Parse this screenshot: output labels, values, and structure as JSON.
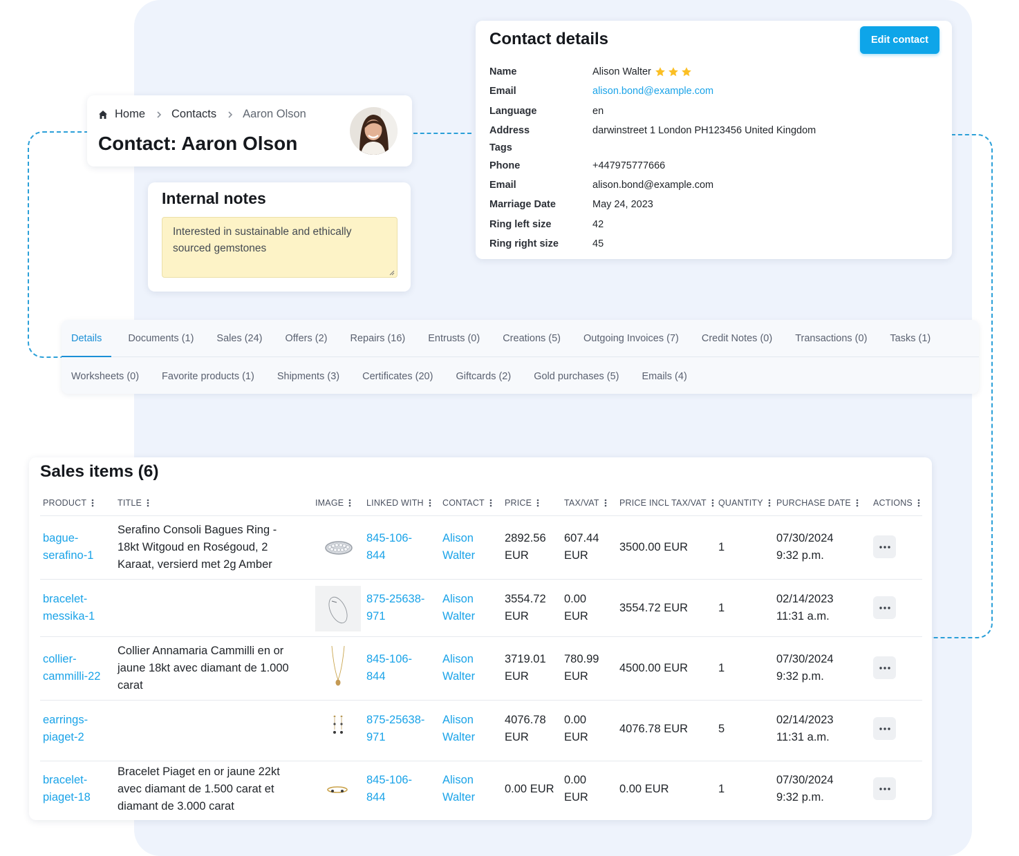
{
  "breadcrumb": {
    "home": "Home",
    "contacts": "Contacts",
    "current": "Aaron Olson"
  },
  "page_title": "Contact: Aaron Olson",
  "internal_notes": {
    "title": "Internal notes",
    "text": "Interested in sustainable and ethically sourced gemstones"
  },
  "contact_details": {
    "title": "Contact details",
    "edit_label": "Edit contact",
    "rating_stars": 3,
    "rows": [
      {
        "label": "Name",
        "value": "Alison Walter"
      },
      {
        "label": "Email",
        "value": "alison.bond@example.com"
      },
      {
        "label": "Language",
        "value": "en"
      },
      {
        "label": "Address",
        "value": "darwinstreet 1 London PH123456 United Kingdom"
      },
      {
        "label": "Tags",
        "value": ""
      },
      {
        "label": "Phone",
        "value": "+447975777666"
      },
      {
        "label": "Email",
        "value": "alison.bond@example.com"
      },
      {
        "label": "Marriage Date",
        "value": "May 24, 2023"
      },
      {
        "label": "Ring left size",
        "value": "42"
      },
      {
        "label": "Ring right size",
        "value": "45"
      }
    ]
  },
  "tabs": {
    "row1": [
      "Details",
      "Documents (1)",
      "Sales (24)",
      "Offers (2)",
      "Repairs (16)",
      "Entrusts (0)",
      "Creations (5)",
      "Outgoing Invoices (7)",
      "Credit Notes (0)",
      "Transactions (0)",
      "Tasks (1)"
    ],
    "row2": [
      "Worksheets (0)",
      "Favorite products (1)",
      "Shipments (3)",
      "Certificates (20)",
      "Giftcards (2)",
      "Gold purchases (5)",
      "Emails (4)"
    ],
    "active": "Details"
  },
  "sales": {
    "title": "Sales items (6)",
    "columns": [
      "PRODUCT",
      "TITLE",
      "IMAGE",
      "LINKED WITH",
      "CONTACT",
      "PRICE",
      "TAX/VAT",
      "PRICE INCL TAX/VAT",
      "QUANTITY",
      "PURCHASE DATE",
      "ACTIONS"
    ],
    "rows": [
      {
        "product": "bague-\nserafino-1",
        "title": "Serafino Consoli Bagues Ring -\n18kt Witgoud en Roségoud, 2\nKaraat, versierd met 2g Amber",
        "image": "ring-image",
        "linked": "845-106-\n844",
        "contact": "Alison\nWalter",
        "price": "2892.56\nEUR",
        "tax": "607.44\nEUR",
        "price_incl": "3500.00 EUR",
        "quantity": "1",
        "date": "07/30/2024\n9:32 p.m."
      },
      {
        "product": "bracelet-\nmessika-1",
        "title": "",
        "image": "bracelet-sketch-image",
        "linked": "875-25638-\n971",
        "contact": "Alison\nWalter",
        "price": "3554.72\nEUR",
        "tax": "0.00\nEUR",
        "price_incl": "3554.72 EUR",
        "quantity": "1",
        "date": "02/14/2023\n11:31 a.m."
      },
      {
        "product": "collier-\ncammilli-22",
        "title": "Collier Annamaria Cammilli en or\njaune 18kt avec diamant de 1.000\ncarat",
        "image": "necklace-image",
        "linked": "845-106-\n844",
        "contact": "Alison\nWalter",
        "price": "3719.01\nEUR",
        "tax": "780.99\nEUR",
        "price_incl": "4500.00 EUR",
        "quantity": "1",
        "date": "07/30/2024\n9:32 p.m."
      },
      {
        "product": "earrings-\npiaget-2",
        "title": "",
        "image": "earrings-image",
        "linked": "875-25638-\n971",
        "contact": "Alison\nWalter",
        "price": "4076.78\nEUR",
        "tax": "0.00\nEUR",
        "price_incl": "4076.78 EUR",
        "quantity": "5",
        "date": "02/14/2023\n11:31 a.m."
      },
      {
        "product": "bracelet-\npiaget-18",
        "title": "Bracelet Piaget en or jaune 22kt\navec diamant de 1.500 carat et\ndiamant de 3.000 carat",
        "image": "bangle-image",
        "linked": "845-106-\n844",
        "contact": "Alison\nWalter",
        "price": "0.00 EUR",
        "tax": "0.00\nEUR",
        "price_incl": "0.00 EUR",
        "quantity": "1",
        "date": "07/30/2024\n9:32 p.m."
      }
    ]
  },
  "colors": {
    "accent": "#0ea5e9",
    "link": "#1aa3e8",
    "notes_bg": "#fdf3c7",
    "star": "#fbbf24",
    "panel_bg": "#eef3fc",
    "dashed_line": "#2a9fd8"
  }
}
